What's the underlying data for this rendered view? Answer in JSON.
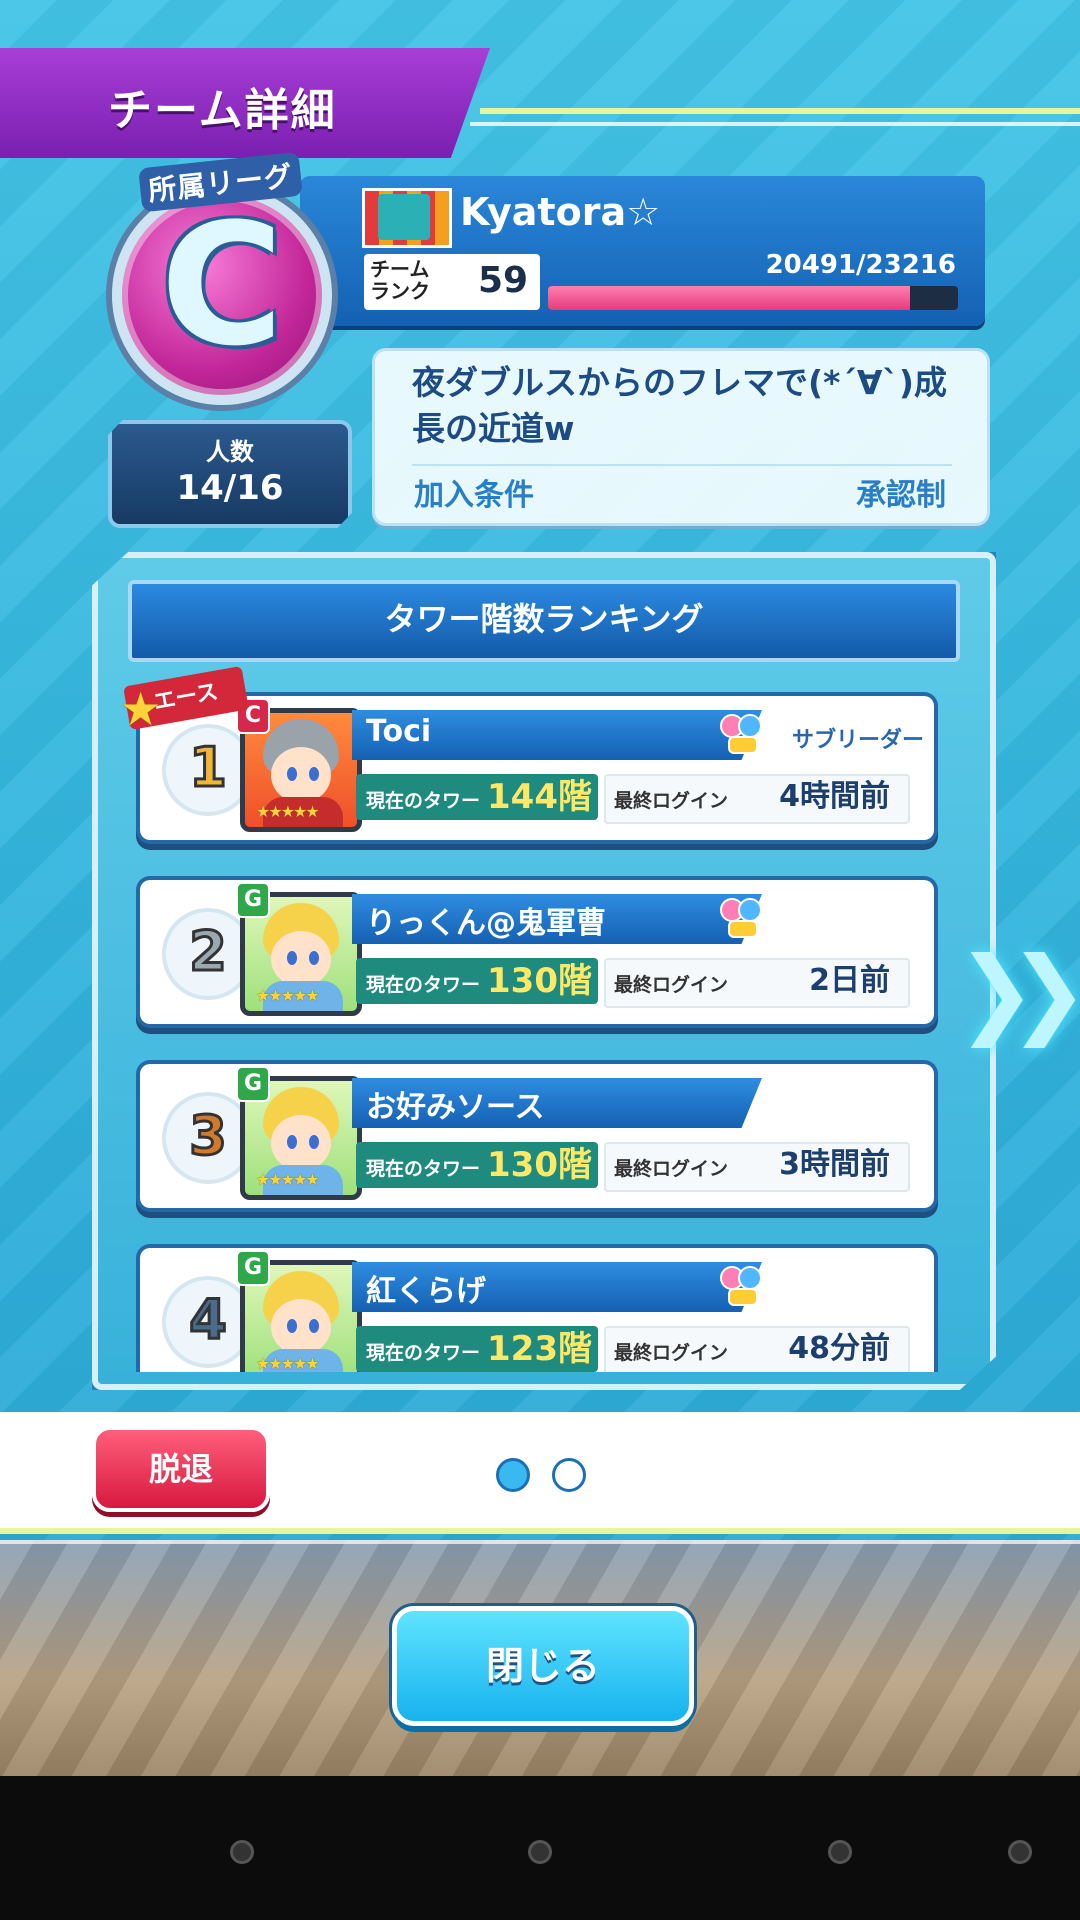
{
  "header": {
    "title": "チーム詳細"
  },
  "league": {
    "label": "所属リーグ",
    "letter": "C"
  },
  "team": {
    "name": "Kyatora☆",
    "rank_label": "チーム\nランク",
    "rank": "59",
    "exp_text": "20491/23216",
    "exp_fraction": 0.883
  },
  "members": {
    "label": "人数",
    "value": "14/16"
  },
  "comment": {
    "text": "夜ダブルスからのフレマで(*´∀`)成長の近道w",
    "join_label": "加入条件",
    "join_value": "承認制"
  },
  "ranking": {
    "title": "タワー階数ランキング",
    "ace_label": "エース",
    "tower_label": "現在のタワー",
    "login_label": "最終ログイン",
    "entries": [
      {
        "rank": "1",
        "name": "Toci",
        "tower": "144階",
        "login": "4時間前",
        "role": "サブリーダー",
        "friend": true,
        "grade": "C"
      },
      {
        "rank": "2",
        "name": "りっくん@鬼軍曹",
        "tower": "130階",
        "login": "2日前",
        "role": "",
        "friend": true,
        "grade": "G"
      },
      {
        "rank": "3",
        "name": "お好みソース",
        "tower": "130階",
        "login": "3時間前",
        "role": "",
        "friend": false,
        "grade": "G"
      },
      {
        "rank": "4",
        "name": "紅くらげ",
        "tower": "123階",
        "login": "48分前",
        "role": "",
        "friend": true,
        "grade": "G"
      }
    ]
  },
  "footer": {
    "leave_label": "脱退",
    "close_label": "閉じる",
    "page_index": 0,
    "page_count": 2
  },
  "colors": {
    "accent": "#1460b3",
    "header": "#8a2bc2",
    "tower_tag": "#1f8b7e",
    "leave": "#d8193f",
    "close": "#17b2ee"
  }
}
